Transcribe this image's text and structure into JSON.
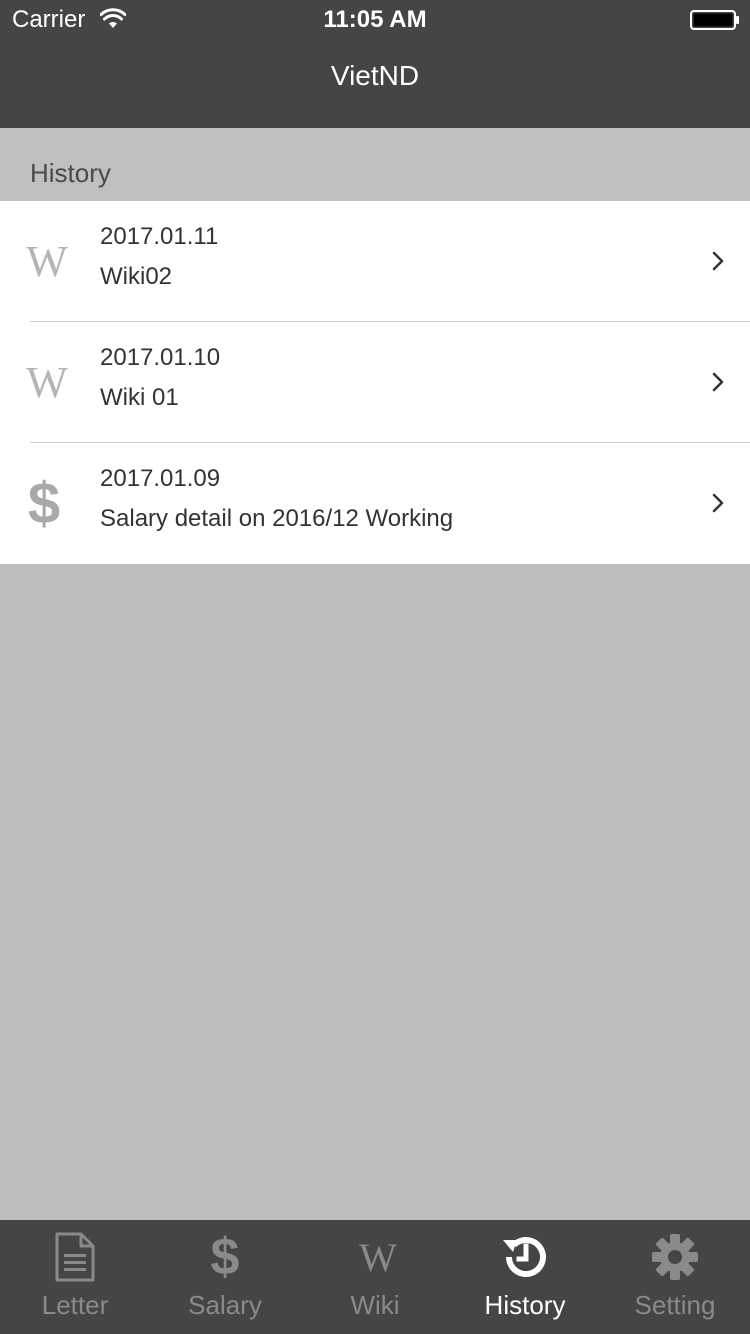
{
  "status_bar": {
    "carrier": "Carrier",
    "time": "11:05 AM"
  },
  "nav": {
    "title": "VietND"
  },
  "section": {
    "title": "History"
  },
  "history_items": [
    {
      "icon": "wiki-icon",
      "icon_glyph": "W",
      "date": "2017.01.11",
      "title": "Wiki02"
    },
    {
      "icon": "wiki-icon",
      "icon_glyph": "W",
      "date": "2017.01.10",
      "title": "Wiki 01"
    },
    {
      "icon": "dollar-icon",
      "icon_glyph": "$",
      "date": "2017.01.09",
      "title": "Salary detail on 2016/12 Working"
    }
  ],
  "tabs": [
    {
      "label": "Letter",
      "icon": "document-icon",
      "active": false
    },
    {
      "label": "Salary",
      "icon": "dollar-icon",
      "icon_glyph": "$",
      "active": false
    },
    {
      "label": "Wiki",
      "icon": "wiki-icon",
      "icon_glyph": "W",
      "active": false
    },
    {
      "label": "History",
      "icon": "history-icon",
      "active": true
    },
    {
      "label": "Setting",
      "icon": "gear-icon",
      "active": false
    }
  ],
  "colors": {
    "bar_background": "#454545",
    "content_background": "#bdbdbd",
    "active_tab": "#ffffff",
    "inactive_tab": "#8a8a8a"
  }
}
